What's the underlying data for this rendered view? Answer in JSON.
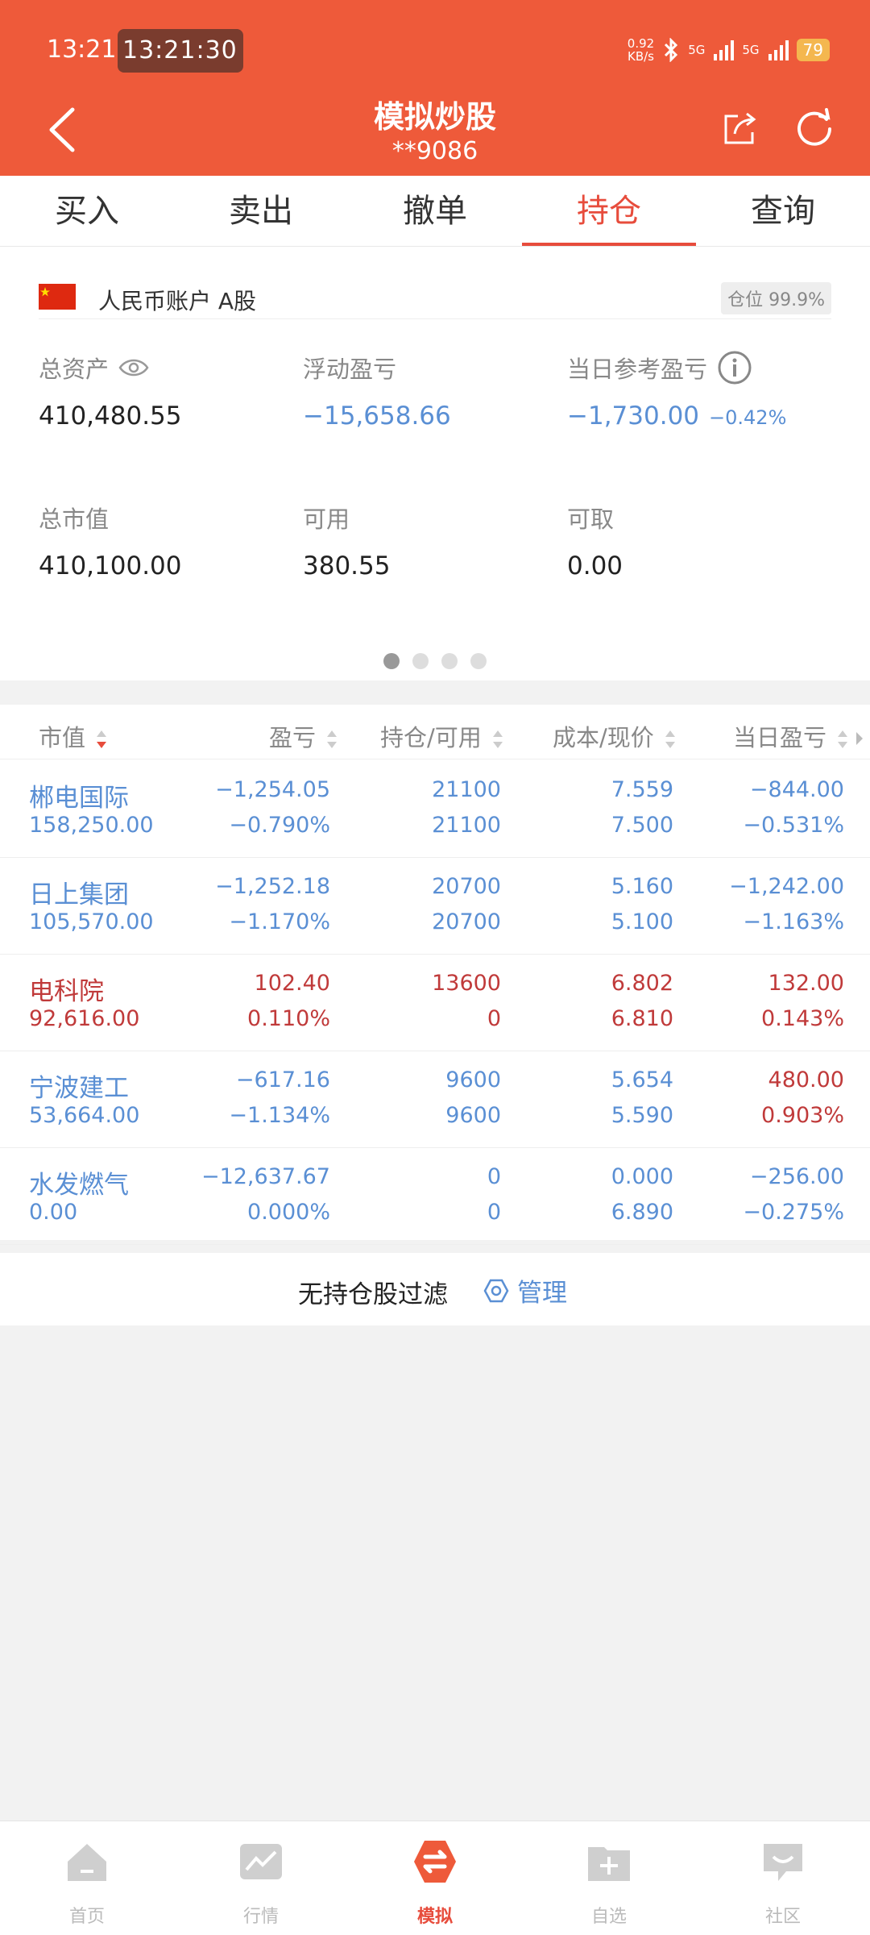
{
  "status_bar": {
    "time": "13:21",
    "pill_time": "13:21:30",
    "kbs_value": "0.92",
    "kbs_unit": "KB/s",
    "net1": "5G",
    "net2": "5G",
    "battery": "79"
  },
  "header": {
    "title": "模拟炒股",
    "account_masked": "**9086"
  },
  "tabs": [
    {
      "label": "买入",
      "active": false
    },
    {
      "label": "卖出",
      "active": false
    },
    {
      "label": "撤单",
      "active": false
    },
    {
      "label": "持仓",
      "active": true
    },
    {
      "label": "查询",
      "active": false
    }
  ],
  "account": {
    "label": "人民币账户 A股",
    "position_badge": "仓位 99.9%"
  },
  "summary": {
    "total_assets_label": "总资产",
    "total_assets": "410,480.55",
    "floating_pl_label": "浮动盈亏",
    "floating_pl": "−15,658.66",
    "daily_pl_label": "当日参考盈亏",
    "daily_pl": "−1,730.00",
    "daily_pl_pct": "−0.42%",
    "market_value_label": "总市值",
    "market_value": "410,100.00",
    "available_label": "可用",
    "available": "380.55",
    "withdrawable_label": "可取",
    "withdrawable": "0.00",
    "page_indicator": {
      "count": 4,
      "active": 0
    }
  },
  "table": {
    "headers": {
      "market_value": "市值",
      "pl": "盈亏",
      "position": "持仓/可用",
      "cost_price": "成本/现价",
      "daily_pl": "当日盈亏"
    },
    "rows": [
      {
        "name": "郴电国际",
        "mv": "158,250.00",
        "pl": "−1,254.05",
        "pl_pct": "−0.790%",
        "pos": "21100",
        "avail": "21100",
        "cost": "7.559",
        "price": "7.500",
        "dpl": "−844.00",
        "dpl_pct": "−0.531%",
        "name_trend": "dn",
        "pl_trend": "dn",
        "pos_trend": "dn",
        "cost_trend": "dn",
        "dpl_trend": "dn"
      },
      {
        "name": "日上集团",
        "mv": "105,570.00",
        "pl": "−1,252.18",
        "pl_pct": "−1.170%",
        "pos": "20700",
        "avail": "20700",
        "cost": "5.160",
        "price": "5.100",
        "dpl": "−1,242.00",
        "dpl_pct": "−1.163%",
        "name_trend": "dn",
        "pl_trend": "dn",
        "pos_trend": "dn",
        "cost_trend": "dn",
        "dpl_trend": "dn"
      },
      {
        "name": "电科院",
        "mv": "92,616.00",
        "pl": "102.40",
        "pl_pct": "0.110%",
        "pos": "13600",
        "avail": "0",
        "cost": "6.802",
        "price": "6.810",
        "dpl": "132.00",
        "dpl_pct": "0.143%",
        "name_trend": "up",
        "pl_trend": "up",
        "pos_trend": "up",
        "cost_trend": "up",
        "dpl_trend": "up"
      },
      {
        "name": "宁波建工",
        "mv": "53,664.00",
        "pl": "−617.16",
        "pl_pct": "−1.134%",
        "pos": "9600",
        "avail": "9600",
        "cost": "5.654",
        "price": "5.590",
        "dpl": "480.00",
        "dpl_pct": "0.903%",
        "name_trend": "dn",
        "pl_trend": "dn",
        "pos_trend": "dn",
        "cost_trend": "dn",
        "dpl_trend": "up"
      },
      {
        "name": "水发燃气",
        "mv": "0.00",
        "pl": "−12,637.67",
        "pl_pct": "0.000%",
        "pos": "0",
        "avail": "0",
        "cost": "0.000",
        "price": "6.890",
        "dpl": "−256.00",
        "dpl_pct": "−0.275%",
        "name_trend": "dn",
        "pl_trend": "dn",
        "pos_trend": "dn",
        "cost_trend": "dn",
        "dpl_trend": "dn"
      }
    ]
  },
  "filter": {
    "text": "无持仓股过滤",
    "manage_label": "管理"
  },
  "bottom_nav": [
    {
      "label": "首页",
      "icon": "home-icon",
      "active": false
    },
    {
      "label": "行情",
      "icon": "market-chart-icon",
      "active": false
    },
    {
      "label": "模拟",
      "icon": "simulate-exchange-icon",
      "active": true
    },
    {
      "label": "自选",
      "icon": "watchlist-add-icon",
      "active": false
    },
    {
      "label": "社区",
      "icon": "community-icon",
      "active": false
    }
  ],
  "colors": {
    "brand": "#ee5a3a",
    "active_tab": "#e74c3c",
    "gain": "#c03a3a",
    "loss": "#5a8fd4"
  }
}
